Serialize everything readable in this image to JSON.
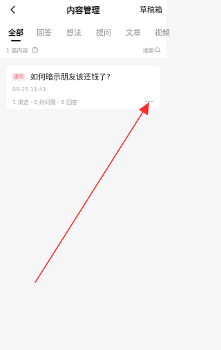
{
  "header": {
    "title": "内容管理",
    "drafts_label": "草稿箱"
  },
  "tabs": [
    {
      "label": "全部",
      "active": true
    },
    {
      "label": "回答",
      "active": false
    },
    {
      "label": "想法",
      "active": false
    },
    {
      "label": "提问",
      "active": false
    },
    {
      "label": "文章",
      "active": false
    },
    {
      "label": "视频",
      "active": false
    }
  ],
  "summary": {
    "count_text": "1 篇内容",
    "search_label": "搜索"
  },
  "card": {
    "badge": "提问",
    "title": "如何暗示朋友该还钱了?",
    "time": "09-25 11:41",
    "stats": "1 浏览 · 0 好问题 · 0 回答"
  },
  "colors": {
    "annotation_arrow": "#ff2a2a",
    "badge_text": "#e8505b",
    "badge_bg": "#fde9ec"
  }
}
